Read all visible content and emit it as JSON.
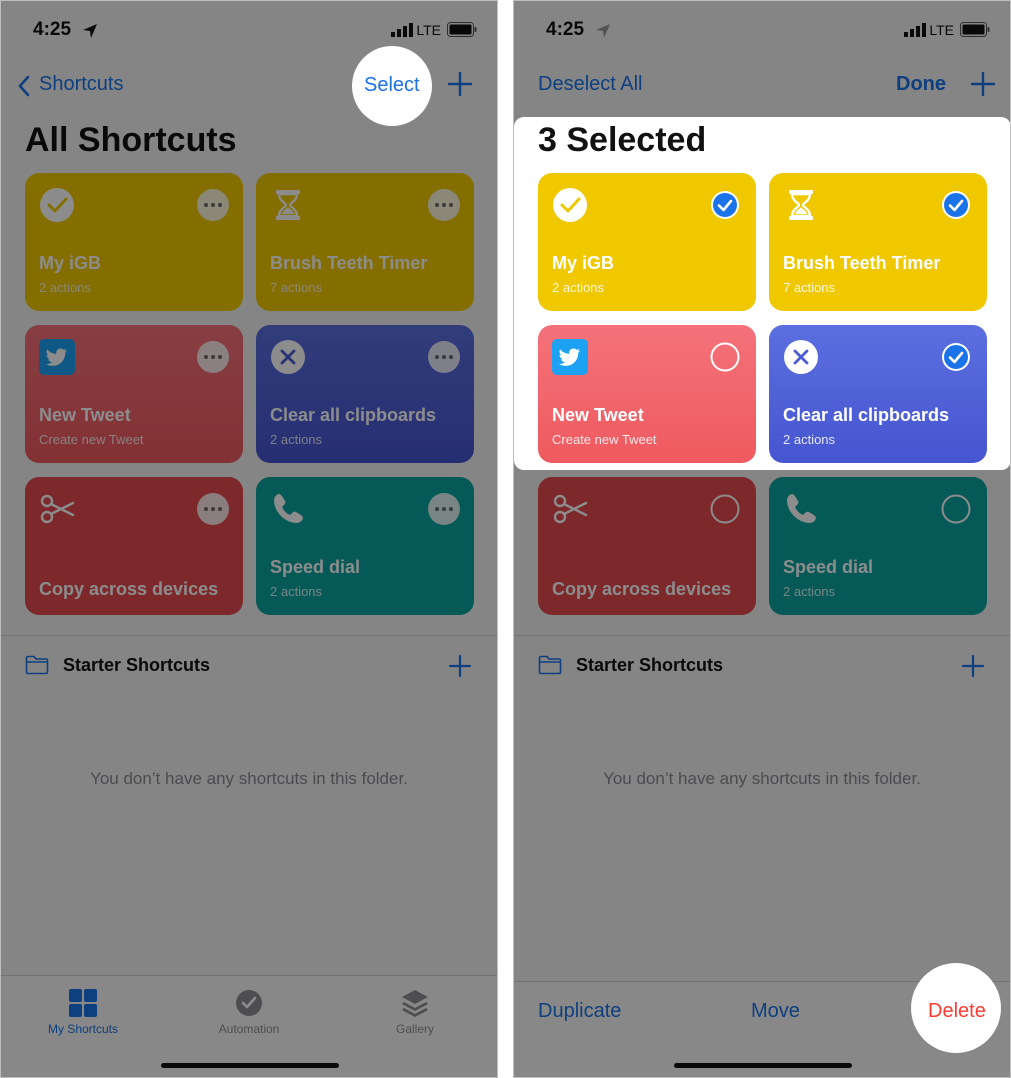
{
  "status": {
    "time": "4:25",
    "network": "LTE"
  },
  "left": {
    "nav": {
      "back_label": "Shortcuts",
      "select_label": "Select"
    },
    "title": "All Shortcuts",
    "shortcuts": [
      {
        "name": "My iGB",
        "subtitle": "2 actions",
        "icon": "checkmark-icon",
        "color": "#f0c800"
      },
      {
        "name": "Brush Teeth Timer",
        "subtitle": "7 actions",
        "icon": "hourglass-icon",
        "color": "#f0c800"
      },
      {
        "name": "New Tweet",
        "subtitle": "Create new Tweet",
        "icon": "twitter-icon",
        "color": "#f06468"
      },
      {
        "name": "Clear all clipboards",
        "subtitle": "2 actions",
        "icon": "x-circle-icon",
        "color": "#4b5bd4"
      },
      {
        "name": "Copy across devices",
        "subtitle": "",
        "icon": "scissors-icon",
        "color": "#e44a4f"
      },
      {
        "name": "Speed dial",
        "subtitle": "2 actions",
        "icon": "phone-icon",
        "color": "#0aa5a0"
      }
    ],
    "folder": {
      "title": "Starter Shortcuts",
      "empty_text": "You don’t have any shortcuts in this folder."
    },
    "tabs": [
      {
        "label": "My Shortcuts",
        "icon": "grid-icon",
        "active": true
      },
      {
        "label": "Automation",
        "icon": "clock-check-icon",
        "active": false
      },
      {
        "label": "Gallery",
        "icon": "layers-icon",
        "active": false
      }
    ]
  },
  "right": {
    "nav": {
      "deselect_label": "Deselect All",
      "done_label": "Done"
    },
    "title": "3 Selected",
    "selected": [
      true,
      true,
      false,
      true,
      false,
      false
    ],
    "shortcuts": [
      {
        "name": "My iGB",
        "subtitle": "2 actions"
      },
      {
        "name": "Brush Teeth Timer",
        "subtitle": "7 actions"
      },
      {
        "name": "New Tweet",
        "subtitle": "Create new Tweet"
      },
      {
        "name": "Clear all clipboards",
        "subtitle": "2 actions"
      },
      {
        "name": "Copy across devices",
        "subtitle": ""
      },
      {
        "name": "Speed dial",
        "subtitle": "2 actions"
      }
    ],
    "folder": {
      "title": "Starter Shortcuts",
      "empty_text": "You don’t have any shortcuts in this folder."
    },
    "actions": {
      "duplicate": "Duplicate",
      "move": "Move",
      "delete": "Delete"
    }
  },
  "colors": {
    "accent": "#1a73e8",
    "destructive": "#ff3b30"
  }
}
